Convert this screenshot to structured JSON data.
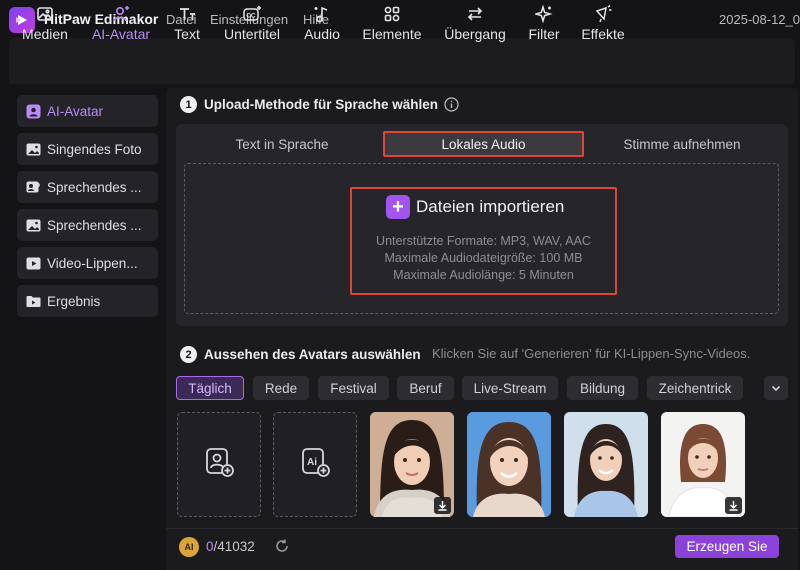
{
  "app": {
    "name": "HitPaw Edimakor",
    "menu": [
      "Datei",
      "Einstellungen",
      "Hilfe"
    ],
    "date": "2025-08-12_0"
  },
  "toolbar": {
    "items": [
      {
        "label": "Medien",
        "icon": "image-icon"
      },
      {
        "label": "AI-Avatar",
        "icon": "avatar-icon",
        "active": true
      },
      {
        "label": "Text",
        "icon": "text-icon"
      },
      {
        "label": "Untertitel",
        "icon": "subtitle-icon"
      },
      {
        "label": "Audio",
        "icon": "music-note-icon"
      },
      {
        "label": "Elemente",
        "icon": "elements-icon"
      },
      {
        "label": "Übergang",
        "icon": "transition-icon"
      },
      {
        "label": "Filter",
        "icon": "sparkle-icon"
      },
      {
        "label": "Effekte",
        "icon": "effects-icon"
      }
    ]
  },
  "sidebar": {
    "items": [
      {
        "label": "AI-Avatar",
        "icon": "avatar-icon",
        "active": true
      },
      {
        "label": "Singendes Foto",
        "icon": "image-icon"
      },
      {
        "label": "Sprechendes ...",
        "icon": "talking-image-icon"
      },
      {
        "label": "Sprechendes ...",
        "icon": "image-icon"
      },
      {
        "label": "Video-Lippen...",
        "icon": "video-icon"
      },
      {
        "label": "Ergebnis",
        "icon": "folder-icon"
      }
    ]
  },
  "upload": {
    "step_number": "1",
    "title": "Upload-Methode für Sprache wählen",
    "tabs": [
      {
        "label": "Text in Sprache"
      },
      {
        "label": "Lokales Audio",
        "active": true
      },
      {
        "label": "Stimme aufnehmen"
      }
    ],
    "import_label": "Dateien importieren",
    "info": [
      "Unterstützte Formate: MP3, WAV, AAC",
      "Maximale Audiodateigröße: 100 MB",
      "Maximale Audiolänge: 5 Minuten"
    ]
  },
  "avatars": {
    "step_number": "2",
    "title": "Aussehen des Avatars auswählen",
    "hint": "Klicken Sie auf 'Generieren' für KI-Lippen-Sync-Videos.",
    "categories": [
      "Täglich",
      "Rede",
      "Festival",
      "Beruf",
      "Live-Stream",
      "Bildung",
      "Zeichentrick"
    ],
    "active_category": "Täglich"
  },
  "footer": {
    "coin_label": "AI",
    "credits_used": "0",
    "credits_total": "/41032",
    "generate_label": "Erzeugen Sie"
  },
  "colors": {
    "accent": "#a255ee",
    "highlight_border": "#e0453a",
    "generate_button": "#8b42d8"
  }
}
